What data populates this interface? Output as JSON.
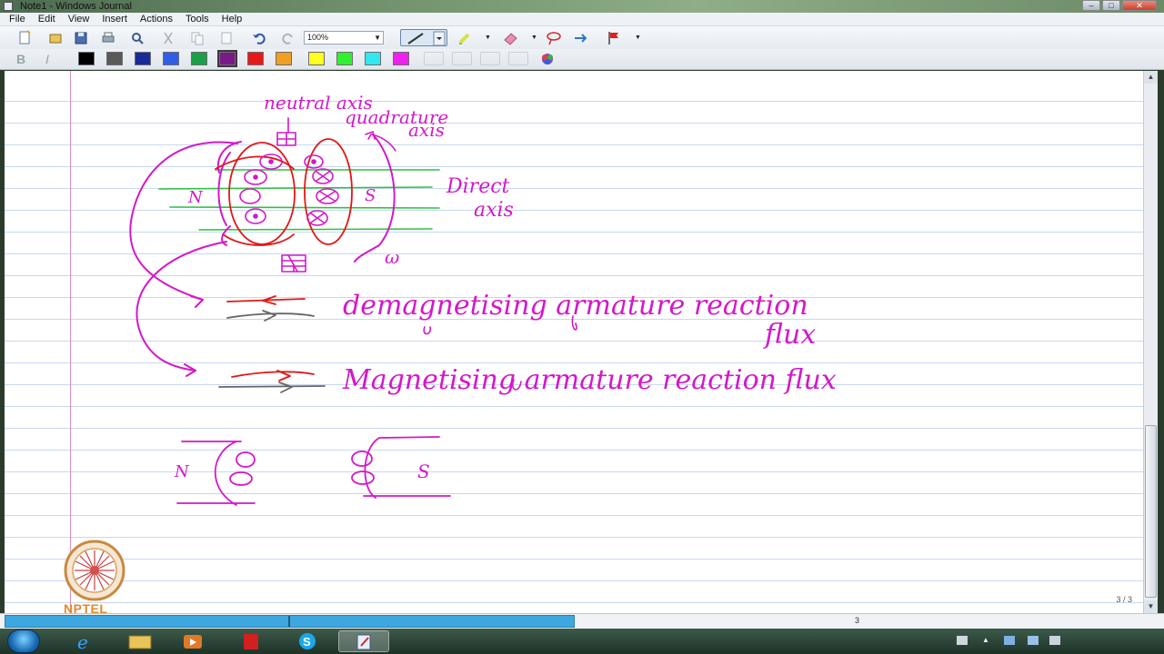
{
  "window": {
    "title": "Note1 - Windows Journal"
  },
  "menu": [
    "File",
    "Edit",
    "View",
    "Insert",
    "Actions",
    "Tools",
    "Help"
  ],
  "toolbar": {
    "zoom_value": "100%"
  },
  "palette": [
    "#000000",
    "#5a5a5a",
    "#1a2a9a",
    "#2f5fe8",
    "#1aa048",
    "#7a1a8a",
    "#e81818",
    "#f0a020",
    "#ffff20",
    "#30f030",
    "#30e8f0",
    "#f020f0"
  ],
  "page": {
    "ink_text": {
      "neutral_axis": "neutral axis",
      "quadrature": "quadrature",
      "quadrature_axis": "axis",
      "direct": "Direct",
      "direct_axis": "axis",
      "pole_n": "N",
      "pole_s": "S",
      "omega": "ω",
      "demag_line1": "demagnetising armature reaction",
      "demag_line2": "flux",
      "mag_line": "Magnetising armature reaction flux",
      "pole_n_2": "N",
      "pole_s_2": "S"
    },
    "page_indicator": "3 / 3"
  },
  "statusbar": {
    "page_number": "3",
    "progress": 0.49
  },
  "logo": {
    "text": "NPTEL"
  }
}
